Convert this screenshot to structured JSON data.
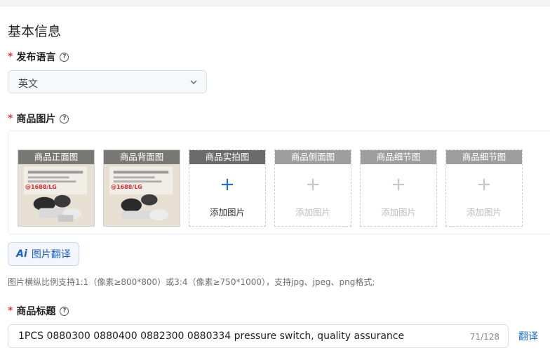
{
  "section_title": "基本信息",
  "language": {
    "required_mark": "*",
    "label": "发布语言",
    "help_icon": "question-circle-icon",
    "selected": "英文"
  },
  "images": {
    "required_mark": "*",
    "label": "商品图片",
    "help_icon": "question-circle-icon",
    "add_label": "添加图片",
    "slots": [
      {
        "caption": "商品正面图",
        "state": "filled"
      },
      {
        "caption": "商品背面图",
        "state": "filled"
      },
      {
        "caption": "商品实拍图",
        "state": "empty-active"
      },
      {
        "caption": "商品侧面图",
        "state": "empty"
      },
      {
        "caption": "商品细节图",
        "state": "empty"
      },
      {
        "caption": "商品细节图",
        "state": "empty"
      }
    ],
    "photo_stamp": "@1688/LG",
    "ai_translate_button": {
      "icon": "Ai",
      "label": "图片翻译"
    },
    "hint": "图片横纵比例支持1:1（像素≥800*800）或3:4（像素≥750*1000），支持jpg、jpeg、png格式;"
  },
  "title": {
    "required_mark": "*",
    "label": "商品标题",
    "help_icon": "question-circle-icon",
    "value": "1PCS 0880300 0880400 0882300 0880334 pressure switch, quality assurance",
    "counter": "71/128",
    "translate_link": "翻译"
  },
  "colors": {
    "accent": "#1a6fd1",
    "required": "#e4393c"
  }
}
